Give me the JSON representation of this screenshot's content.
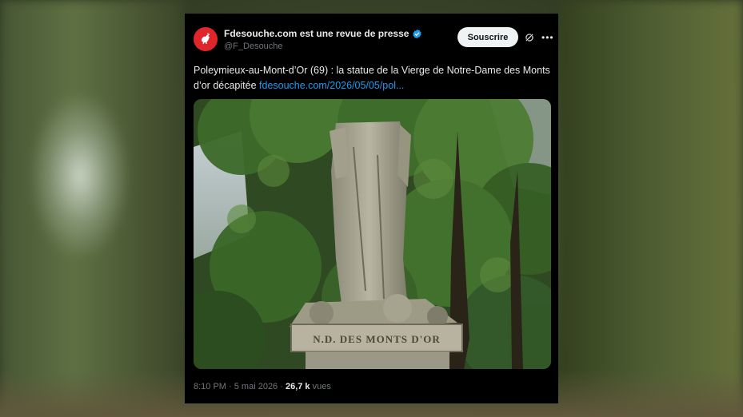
{
  "tweet": {
    "display_name": "Fdesouche.com est une revue de presse",
    "handle": "@F_Desouche",
    "follow_label": "Souscrire",
    "text_main": "Poleymieux-au-Mont-d’Or (69) : la statue de la Vierge de Notre-Dame des Monts d’or décapitée ",
    "text_link": "fdesouche.com/2026/05/05/pol...",
    "time": "8:10 PM",
    "separator": " · ",
    "date": "5 mai 2026",
    "views_count": "26,7 k",
    "views_label": "vues"
  },
  "media": {
    "inscription": "N.D. DES MONTS D'OR"
  },
  "colors": {
    "accent": "#1d9bf0",
    "avatar_bg": "#e0262b"
  },
  "icons": [
    "verified-badge-icon",
    "grok-icon",
    "more-options-icon",
    "rooster-logo-icon"
  ]
}
